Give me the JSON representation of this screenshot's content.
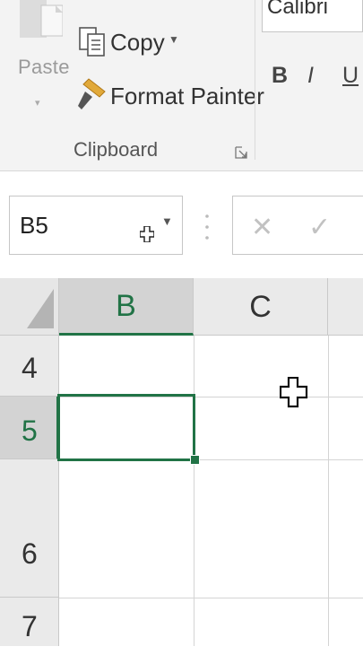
{
  "ribbon": {
    "paste_label": "Paste",
    "copy_label": "Copy",
    "format_painter_label": "Format Painter",
    "group_label": "Clipboard",
    "font_name": "Calibri",
    "bold_label": "B",
    "italic_label": "I",
    "underline_label": "U"
  },
  "formula_bar": {
    "name_box_value": "B5",
    "cancel_glyph": "✕",
    "enter_glyph": "✓"
  },
  "sheet": {
    "columns": [
      "B",
      "C"
    ],
    "rows": [
      "4",
      "5",
      "6",
      "7"
    ],
    "active_cell": "B5"
  },
  "colors": {
    "accent": "#217346",
    "ribbon_bg": "#f3f3f3",
    "header_bg": "#eaeaea",
    "selected_header_bg": "#d3d3d3"
  },
  "icons": {
    "paste": "paste-icon",
    "copy": "copy-icon",
    "format_painter": "paintbrush-icon",
    "dialog_launcher": "dialog-launcher-icon",
    "cursor": "cell-select-cursor-icon"
  }
}
